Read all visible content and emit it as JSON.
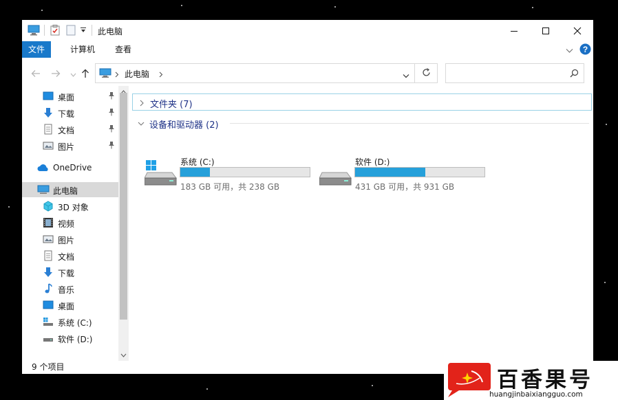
{
  "window": {
    "title": "此电脑",
    "colors": {
      "accent": "#1979ca",
      "bar_fill": "#26a0da",
      "selection": "#d9d9d9",
      "group_text": "#1e3287"
    }
  },
  "ribbon": {
    "tabs": [
      {
        "label": "文件"
      },
      {
        "label": "计算机"
      },
      {
        "label": "查看"
      }
    ]
  },
  "address": {
    "path": "此电脑",
    "search_placeholder": ""
  },
  "nav": {
    "items": [
      {
        "label": "桌面",
        "icon": "desktop-icon",
        "pinned": true
      },
      {
        "label": "下载",
        "icon": "download-icon",
        "pinned": true
      },
      {
        "label": "文档",
        "icon": "document-icon",
        "pinned": true
      },
      {
        "label": "图片",
        "icon": "picture-icon",
        "pinned": true
      },
      {
        "label": "OneDrive",
        "icon": "onedrive-cloud-icon"
      },
      {
        "label": "此电脑",
        "icon": "this-pc-icon",
        "selected": true
      },
      {
        "label": "3D 对象",
        "icon": "3d-objects-icon"
      },
      {
        "label": "视频",
        "icon": "video-icon"
      },
      {
        "label": "图片",
        "icon": "picture-icon"
      },
      {
        "label": "文档",
        "icon": "document-icon"
      },
      {
        "label": "下载",
        "icon": "download-icon"
      },
      {
        "label": "音乐",
        "icon": "music-icon"
      },
      {
        "label": "桌面",
        "icon": "desktop-icon"
      },
      {
        "label": "系统 (C:)",
        "icon": "system-drive-icon"
      },
      {
        "label": "软件 (D:)",
        "icon": "drive-icon"
      }
    ]
  },
  "content": {
    "folders_group": "文件夹 (7)",
    "devices_group": "设备和驱动器 (2)",
    "drives": [
      {
        "name": "系统 (C:)",
        "free_text": "183 GB 可用，共 238 GB",
        "used_fraction": 0.23
      },
      {
        "name": "软件 (D:)",
        "free_text": "431 GB 可用，共 931 GB",
        "used_fraction": 0.54
      }
    ]
  },
  "status": {
    "text": "9 个项目"
  },
  "watermark": {
    "title": "百香果号",
    "url": "huangjinbaixiangguo.com"
  }
}
